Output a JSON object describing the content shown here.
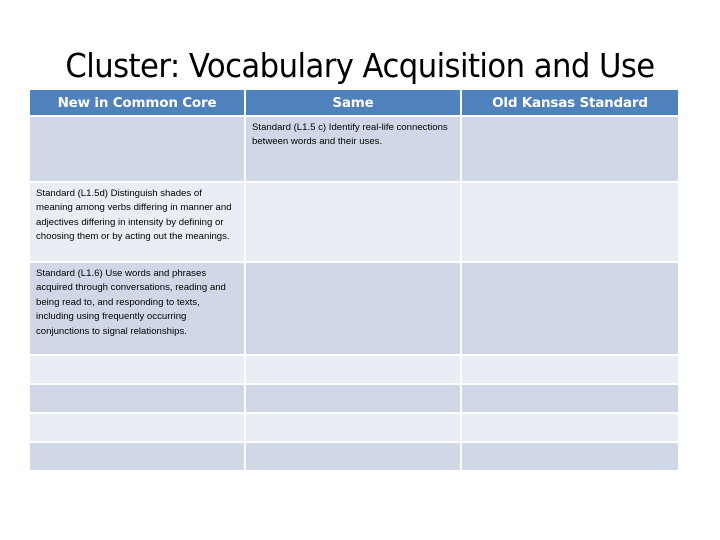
{
  "slide": {
    "title": "Cluster:  Vocabulary Acquisition and Use"
  },
  "table": {
    "headers": [
      "New in Common Core",
      "Same",
      "Old Kansas Standard"
    ],
    "rows": [
      [
        "",
        "Standard  (L1.5 c) Identify real-life connections between words and their uses.",
        ""
      ],
      [
        "Standard (L1.5d) Distinguish shades of meaning among verbs differing in manner  and adjectives differing in intensity by defining or choosing them or by acting out the meanings.",
        "",
        ""
      ],
      [
        "Standard (L1.6) Use words and phrases acquired through conversations, reading and being read to, and responding to texts, including using frequently occurring conjunctions to signal relationships.",
        "",
        ""
      ],
      [
        "",
        "",
        ""
      ],
      [
        "",
        "",
        ""
      ],
      [
        "",
        "",
        ""
      ],
      [
        "",
        "",
        ""
      ]
    ]
  },
  "colors": {
    "header_bg": "#4f81bd",
    "row_dark": "#d0d8e8",
    "row_light": "#e9edf4"
  }
}
